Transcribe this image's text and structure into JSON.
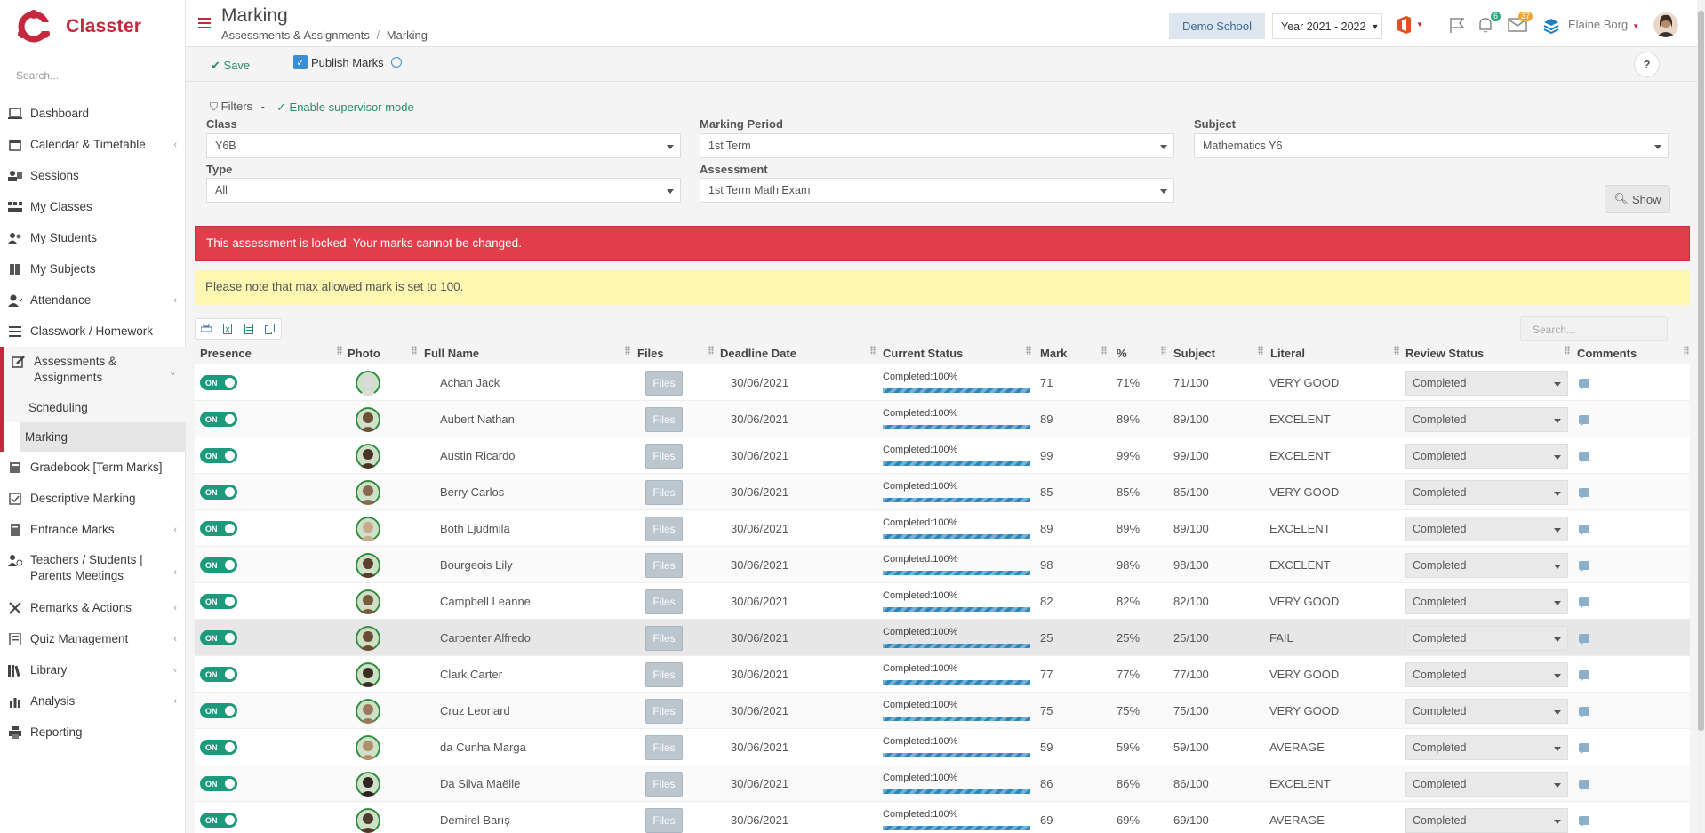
{
  "app": {
    "name": "Classter",
    "search_placeholder": "Search..."
  },
  "sidebar": {
    "items": [
      {
        "label": "Dashboard",
        "icon": "laptop-icon",
        "arrow": false
      },
      {
        "label": "Calendar & Timetable",
        "icon": "calendar-icon",
        "arrow": true
      },
      {
        "label": "Sessions",
        "icon": "sessions-icon",
        "arrow": false
      },
      {
        "label": "My Classes",
        "icon": "classes-icon",
        "arrow": false
      },
      {
        "label": "My Students",
        "icon": "students-icon",
        "arrow": false
      },
      {
        "label": "My Subjects",
        "icon": "book-icon",
        "arrow": false
      },
      {
        "label": "Attendance",
        "icon": "attendance-icon",
        "arrow": true
      },
      {
        "label": "Classwork / Homework",
        "icon": "list-icon",
        "arrow": false
      },
      {
        "label": "Assessments & Assignments",
        "icon": "edit-icon",
        "arrow": true
      },
      {
        "label": "Gradebook [Term Marks]",
        "icon": "gradebook-icon",
        "arrow": false
      },
      {
        "label": "Descriptive Marking",
        "icon": "descriptive-icon",
        "arrow": false
      },
      {
        "label": "Entrance Marks",
        "icon": "entrance-icon",
        "arrow": true
      },
      {
        "label": "Teachers / Students | Parents Meetings",
        "icon": "meetings-icon",
        "arrow": true
      },
      {
        "label": "Remarks & Actions",
        "icon": "remarks-icon",
        "arrow": true
      },
      {
        "label": "Quiz Management",
        "icon": "quiz-icon",
        "arrow": true
      },
      {
        "label": "Library",
        "icon": "library-icon",
        "arrow": true
      },
      {
        "label": "Analysis",
        "icon": "chart-icon",
        "arrow": true
      },
      {
        "label": "Reporting",
        "icon": "printer-icon",
        "arrow": false
      }
    ],
    "subitems": [
      "Scheduling",
      "Marking"
    ]
  },
  "header": {
    "title": "Marking",
    "breadcrumb": [
      "Assessments & Assignments",
      "/",
      "Marking"
    ],
    "school": "Demo School",
    "year": "Year 2021 - 2022",
    "notifications_count": "6",
    "messages_count": "37",
    "user_name": "Elaine Borg"
  },
  "toolbar": {
    "save_label": "Save",
    "publish_label": "Publish Marks",
    "help_label": "?"
  },
  "filters": {
    "title": "Filters",
    "separator": "-",
    "supervisor_label": "Enable supervisor mode",
    "class_label": "Class",
    "class_value": "Y6B",
    "period_label": "Marking Period",
    "period_value": "1st Term",
    "subject_label": "Subject",
    "subject_value": "Mathematics Y6",
    "type_label": "Type",
    "type_value": "All",
    "assessment_label": "Assessment",
    "assessment_value": "1st Term Math Exam",
    "show_label": "Show"
  },
  "alerts": {
    "locked": "This assessment is locked. Your marks cannot be changed.",
    "note": "Please note that max allowed mark is set to 100."
  },
  "table": {
    "search_placeholder": "Search...",
    "headers": [
      "Presence",
      "Photo",
      "Full Name",
      "Files",
      "Deadline Date",
      "Current Status",
      "Mark",
      "%",
      "Subject",
      "Literal",
      "Review Status",
      "Comments"
    ],
    "toggle_label": "ON",
    "files_label": "Files",
    "rows": [
      {
        "name": "Achan Jack",
        "date": "30/06/2021",
        "status": "Completed:100%",
        "progress": 100,
        "mark": "71",
        "pct": "71%",
        "subject": "71/100",
        "literal": "VERY GOOD",
        "review": "Completed",
        "photo_color": "#dcdcdc"
      },
      {
        "name": "Aubert Nathan",
        "date": "30/06/2021",
        "status": "Completed:100%",
        "progress": 100,
        "mark": "89",
        "pct": "89%",
        "subject": "89/100",
        "literal": "EXCELENT",
        "review": "Completed",
        "photo_color": "#6e5038"
      },
      {
        "name": "Austin Ricardo",
        "date": "30/06/2021",
        "status": "Completed:100%",
        "progress": 100,
        "mark": "99",
        "pct": "99%",
        "subject": "99/100",
        "literal": "EXCELENT",
        "review": "Completed",
        "photo_color": "#4a3424"
      },
      {
        "name": "Berry Carlos",
        "date": "30/06/2021",
        "status": "Completed:100%",
        "progress": 100,
        "mark": "85",
        "pct": "85%",
        "subject": "85/100",
        "literal": "VERY GOOD",
        "review": "Completed",
        "photo_color": "#8a6a4e"
      },
      {
        "name": "Both Ljudmila",
        "date": "30/06/2021",
        "status": "Completed:100%",
        "progress": 100,
        "mark": "89",
        "pct": "89%",
        "subject": "89/100",
        "literal": "EXCELENT",
        "review": "Completed",
        "photo_color": "#c9a98c"
      },
      {
        "name": "Bourgeois Lily",
        "date": "30/06/2021",
        "status": "Completed:100%",
        "progress": 100,
        "mark": "98",
        "pct": "98%",
        "subject": "98/100",
        "literal": "EXCELENT",
        "review": "Completed",
        "photo_color": "#5a3e2c"
      },
      {
        "name": "Campbell Leanne",
        "date": "30/06/2021",
        "status": "Completed:100%",
        "progress": 100,
        "mark": "82",
        "pct": "82%",
        "subject": "82/100",
        "literal": "VERY GOOD",
        "review": "Completed",
        "photo_color": "#7a5a3c"
      },
      {
        "name": "Carpenter Alfredo",
        "date": "30/06/2021",
        "status": "Completed:100%",
        "progress": 100,
        "mark": "25",
        "pct": "25%",
        "subject": "25/100",
        "literal": "FAIL",
        "review": "Completed",
        "photo_color": "#6b4e32",
        "highlight": true
      },
      {
        "name": "Clark Carter",
        "date": "30/06/2021",
        "status": "Completed:100%",
        "progress": 100,
        "mark": "77",
        "pct": "77%",
        "subject": "77/100",
        "literal": "VERY GOOD",
        "review": "Completed",
        "photo_color": "#3c2e26"
      },
      {
        "name": "Cruz Leonard",
        "date": "30/06/2021",
        "status": "Completed:100%",
        "progress": 100,
        "mark": "75",
        "pct": "75%",
        "subject": "75/100",
        "literal": "VERY GOOD",
        "review": "Completed",
        "photo_color": "#9a7a5c"
      },
      {
        "name": "da Cunha Marga",
        "date": "30/06/2021",
        "status": "Completed:100%",
        "progress": 100,
        "mark": "59",
        "pct": "59%",
        "subject": "59/100",
        "literal": "AVERAGE",
        "review": "Completed",
        "photo_color": "#b08e6e"
      },
      {
        "name": "Da Silva Maëlle",
        "date": "30/06/2021",
        "status": "Completed:100%",
        "progress": 100,
        "mark": "86",
        "pct": "86%",
        "subject": "86/100",
        "literal": "EXCELENT",
        "review": "Completed",
        "photo_color": "#2e2420"
      },
      {
        "name": "Demirel Barış",
        "date": "30/06/2021",
        "status": "Completed:100%",
        "progress": 100,
        "mark": "69",
        "pct": "69%",
        "subject": "69/100",
        "literal": "AVERAGE",
        "review": "Completed",
        "photo_color": "#4e3a2a"
      }
    ]
  },
  "colors": {
    "brand": "#c5283d",
    "accent_green": "#1d9a7c",
    "alert_red": "#e13d4a",
    "alert_yellow": "#fcf8b2",
    "progress_blue": "#2f86bd"
  }
}
